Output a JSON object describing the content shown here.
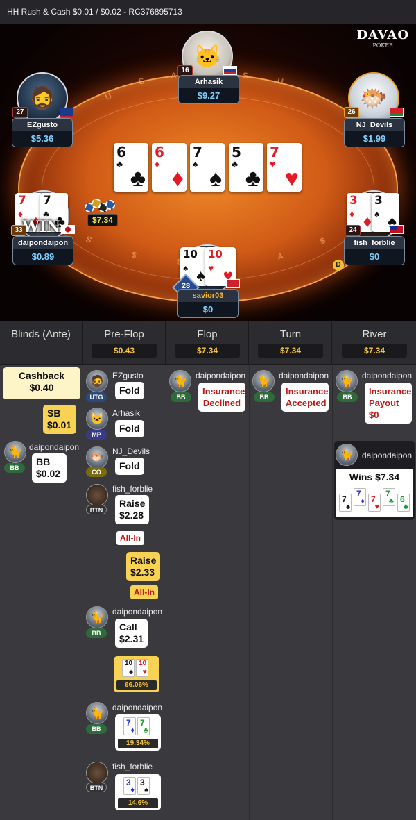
{
  "header": {
    "title": "HH  Rush & Cash $0.01 / $0.02   - RC376895713"
  },
  "logo": {
    "line1": "DAVAO",
    "line2": "POKER"
  },
  "rail_letters": [
    "U",
    "S",
    "A",
    "S",
    "U",
    "S",
    "A",
    "$",
    "$",
    "$"
  ],
  "players": {
    "arhasik": {
      "name": "Arhasik",
      "amount": "$9.27",
      "level": "16"
    },
    "ezgusto": {
      "name": "EZgusto",
      "amount": "$5.36",
      "level": "27"
    },
    "nj_devils": {
      "name": "NJ_Devils",
      "amount": "$1.99",
      "level": "26"
    },
    "daipon": {
      "name": "daipondaipon",
      "amount": "$0.89",
      "level": "33",
      "win_badge": "WIN"
    },
    "fish": {
      "name": "fish_forblie",
      "amount": "$0",
      "level": "24"
    },
    "savior": {
      "name": "savior03",
      "amount": "$0",
      "level": "28"
    }
  },
  "board": [
    {
      "rank": "6",
      "suit": "♣",
      "color": "black"
    },
    {
      "rank": "6",
      "suit": "♦",
      "color": "red"
    },
    {
      "rank": "7",
      "suit": "♠",
      "color": "black"
    },
    {
      "rank": "5",
      "suit": "♣",
      "color": "black"
    },
    {
      "rank": "7",
      "suit": "♥",
      "color": "red"
    }
  ],
  "hole_cards": {
    "daipon": [
      {
        "rank": "7",
        "suit": "♦",
        "color": "red"
      },
      {
        "rank": "7",
        "suit": "♣",
        "color": "black"
      }
    ],
    "fish": [
      {
        "rank": "3",
        "suit": "♦",
        "color": "red"
      },
      {
        "rank": "3",
        "suit": "♠",
        "color": "black"
      }
    ],
    "savior": [
      {
        "rank": "10",
        "suit": "♠",
        "color": "black"
      },
      {
        "rank": "10",
        "suit": "♥",
        "color": "red"
      }
    ]
  },
  "pot_on_table": "$7.34",
  "dealer_button": "D",
  "columns": [
    {
      "title": "Blinds (Ante)",
      "pot": ""
    },
    {
      "title": "Pre-Flop",
      "pot": "$0.43"
    },
    {
      "title": "Flop",
      "pot": "$7.34"
    },
    {
      "title": "Turn",
      "pot": "$7.34"
    },
    {
      "title": "River",
      "pot": "$7.34"
    }
  ],
  "blinds": {
    "cashback_label": "Cashback",
    "cashback_amount": "$0.40",
    "sb_label": "SB",
    "sb_amount": "$0.01",
    "bb_player": "daipondaipon",
    "bb_pos": "BB",
    "bb_label": "BB",
    "bb_amount": "$0.02"
  },
  "preflop": {
    "a1": {
      "player": "EZgusto",
      "pos": "UTG",
      "action": "Fold"
    },
    "a2": {
      "player": "Arhasik",
      "pos": "MP",
      "action": "Fold"
    },
    "a3": {
      "player": "NJ_Devils",
      "pos": "CO",
      "action": "Fold"
    },
    "a4": {
      "player": "fish_forblie",
      "pos": "BTN",
      "action": "Raise",
      "amount": "$2.28",
      "allin": "All-In"
    },
    "a5": {
      "action": "Raise",
      "amount": "$2.33",
      "allin": "All-In"
    },
    "a6": {
      "player": "daipondaipon",
      "pos": "BB",
      "action": "Call",
      "amount": "$2.31"
    },
    "eq1": {
      "pct": "66.06%"
    },
    "eq2": {
      "player": "daipondaipon",
      "pos": "BB",
      "pct": "19.34%"
    },
    "eq3": {
      "player": "fish_forblie",
      "pos": "BTN",
      "pct": "14.6%"
    }
  },
  "flop": {
    "player": "daipondaipon",
    "pos": "BB",
    "line1": "Insurance",
    "line2": "Declined"
  },
  "turn": {
    "player": "daipondaipon",
    "pos": "BB",
    "line1": "Insurance",
    "line2": "Accepted"
  },
  "river": {
    "player": "daipondaipon",
    "pos": "BB",
    "line1": "Insurance",
    "line2": "Payout",
    "amount": "$0",
    "winner": "daipondaipon",
    "wins": "Wins $7.34",
    "cards": [
      {
        "rank": "7",
        "suit": "♠",
        "color": "black"
      },
      {
        "rank": "7",
        "suit": "♦",
        "color": "blue"
      },
      {
        "rank": "7",
        "suit": "♥",
        "color": "red"
      },
      {
        "rank": "7",
        "suit": "♣",
        "color": "green"
      },
      {
        "rank": "6",
        "suit": "♣",
        "color": "green"
      }
    ]
  },
  "colors": {
    "felt": "#d05a16",
    "pot_text": "#f6c53a",
    "chip_blue": "#7fd0ff",
    "bubble_yellow": "#f8d253"
  }
}
